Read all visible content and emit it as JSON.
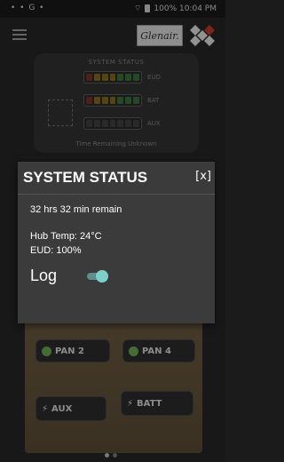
{
  "status_bar": {
    "left": "• • G •",
    "right": "100% 10:04 PM"
  },
  "app_bar": {
    "logo_text": "Glenair."
  },
  "background_card": {
    "title": "SYSTEM STATUS",
    "meters": [
      {
        "label": "EUD",
        "colors": [
          "#c0392b",
          "#d4a017",
          "#d4a017",
          "#d4a017",
          "#4caf50",
          "#4caf50",
          "#4caf50"
        ]
      },
      {
        "label": "BAT",
        "colors": [
          "#c0392b",
          "#d4a017",
          "#d4a017",
          "#d4a017",
          "#4caf50",
          "#4caf50",
          "#4caf50"
        ]
      },
      {
        "label": "AUX",
        "colors": [
          "#555555",
          "#555555",
          "#555555",
          "#555555",
          "#555555",
          "#555555",
          "#555555"
        ]
      }
    ],
    "footer": "Time Remaining Unknown"
  },
  "panel_buttons": {
    "pan2": "PAN 2",
    "pan4": "PAN 4",
    "aux": "AUX",
    "batt": "BATT"
  },
  "dialog": {
    "title": "SYSTEM STATUS",
    "close": "[x]",
    "remaining": "32 hrs 32 min remain",
    "hub_temp": "Hub Temp: 24°C",
    "eud": "EUD: 100%",
    "log_label": "Log",
    "log_enabled": true
  },
  "pager": {
    "pages": 2,
    "active": 0
  },
  "colors": {
    "accent_toggle": "#7ecfc9",
    "dialog_bg": "#3b3b3b"
  }
}
